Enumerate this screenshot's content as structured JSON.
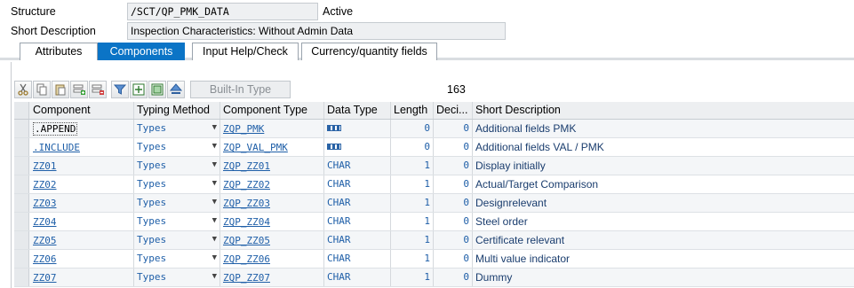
{
  "header": {
    "structure_label": "Structure",
    "structure_value": "/SCT/QP_PMK_DATA",
    "status": "Active",
    "short_desc_label": "Short Description",
    "short_desc_value": "Inspection Characteristics: Without Admin Data"
  },
  "tabs": [
    {
      "label": "Attributes"
    },
    {
      "label": "Components",
      "active": true
    },
    {
      "label": "Input Help/Check"
    },
    {
      "label": "Currency/quantity fields"
    }
  ],
  "toolbar": {
    "icons": [
      "cut-icon",
      "copy-icon",
      "paste-icon",
      "insert-row-icon",
      "delete-row-icon",
      "filter-icon",
      "expand-icon",
      "collapse-icon",
      "sort-icon"
    ],
    "builtin_type_label": "Built-In Type",
    "count": "163"
  },
  "table": {
    "columns": [
      "Component",
      "Typing Method",
      "Component Type",
      "Data Type",
      "Length",
      "Deci...",
      "Short Description"
    ],
    "rows": [
      {
        "component": ".APPEND",
        "typing": "Types",
        "ctype": "ZQP_PMK",
        "dtype": "",
        "length": "0",
        "decimals": "0",
        "desc": "Additional fields PMK"
      },
      {
        "component": ".INCLUDE",
        "typing": "Types",
        "ctype": "ZQP_VAL_PMK",
        "dtype": "",
        "length": "0",
        "decimals": "0",
        "desc": "Additional fields VAL / PMK"
      },
      {
        "component": "ZZ01",
        "typing": "Types",
        "ctype": "ZQP_ZZ01",
        "dtype": "CHAR",
        "length": "1",
        "decimals": "0",
        "desc": "Display initially"
      },
      {
        "component": "ZZ02",
        "typing": "Types",
        "ctype": "ZQP_ZZ02",
        "dtype": "CHAR",
        "length": "1",
        "decimals": "0",
        "desc": "Actual/Target Comparison"
      },
      {
        "component": "ZZ03",
        "typing": "Types",
        "ctype": "ZQP_ZZ03",
        "dtype": "CHAR",
        "length": "1",
        "decimals": "0",
        "desc": "Designrelevant"
      },
      {
        "component": "ZZ04",
        "typing": "Types",
        "ctype": "ZQP_ZZ04",
        "dtype": "CHAR",
        "length": "1",
        "decimals": "0",
        "desc": "Steel order"
      },
      {
        "component": "ZZ05",
        "typing": "Types",
        "ctype": "ZQP_ZZ05",
        "dtype": "CHAR",
        "length": "1",
        "decimals": "0",
        "desc": "Certificate relevant"
      },
      {
        "component": "ZZ06",
        "typing": "Types",
        "ctype": "ZQP_ZZ06",
        "dtype": "CHAR",
        "length": "1",
        "decimals": "0",
        "desc": "Multi value indicator"
      },
      {
        "component": "ZZ07",
        "typing": "Types",
        "ctype": "ZQP_ZZ07",
        "dtype": "CHAR",
        "length": "1",
        "decimals": "0",
        "desc": "Dummy"
      }
    ]
  },
  "colors": {
    "accent": "#0b74c6",
    "link": "#1f5fa8"
  }
}
